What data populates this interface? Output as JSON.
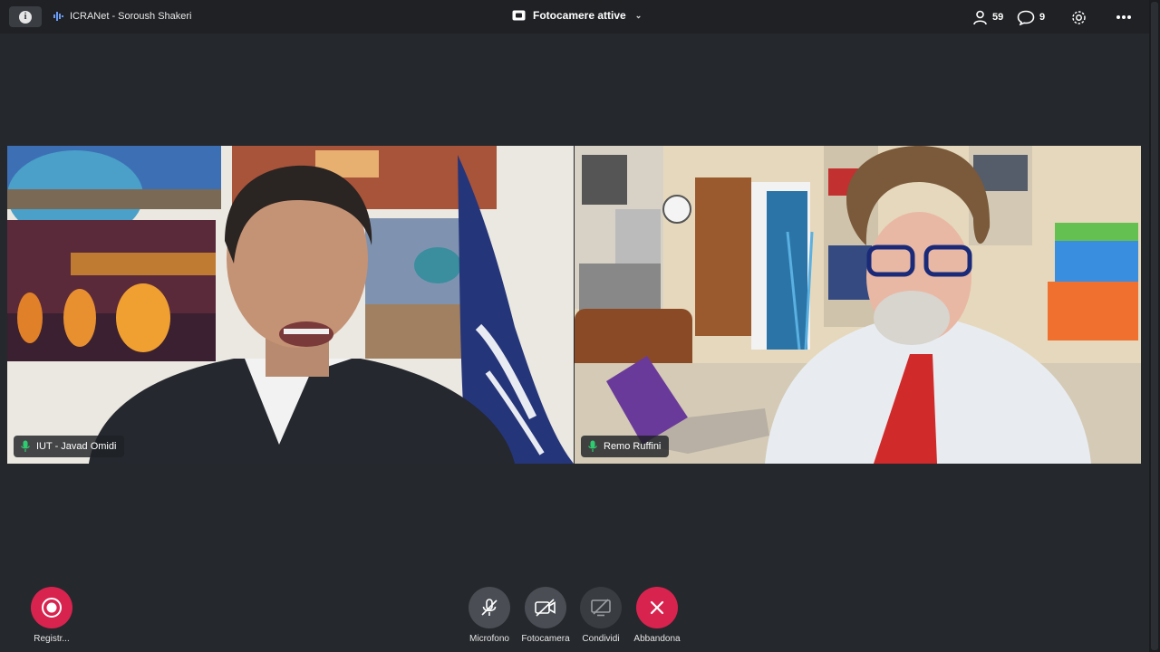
{
  "topbar": {
    "info_icon": "info-icon",
    "meeting_name": "ICRANet - Soroush Shakeri",
    "view_title": "Fotocamere attive",
    "participants_count": "59",
    "chat_count": "9"
  },
  "tiles": [
    {
      "name": "IUT - Javad Omidi",
      "mic": "mic-on-icon"
    },
    {
      "name": "Remo Ruffini",
      "mic": "mic-on-icon"
    }
  ],
  "controls": {
    "record": "Registr...",
    "microphone": "Microfono",
    "camera": "Fotocamera",
    "share": "Condividi",
    "leave": "Abbandona"
  },
  "colors": {
    "background": "#25282c",
    "topbar": "#1f2124",
    "leave_red": "#d8234f",
    "mic_green": "#2ecc71"
  }
}
